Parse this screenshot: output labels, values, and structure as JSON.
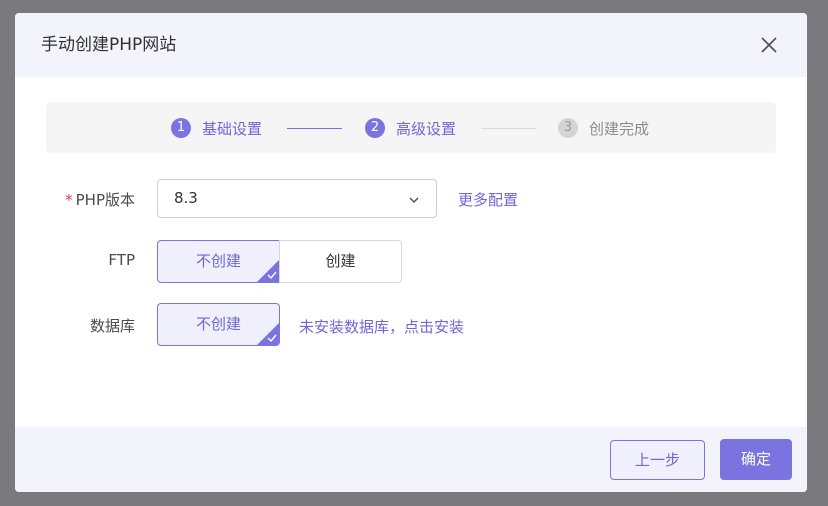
{
  "dialog": {
    "title": "手动创建PHP网站"
  },
  "steps": [
    {
      "num": "1",
      "label": "基础设置",
      "state": "done"
    },
    {
      "num": "2",
      "label": "高级设置",
      "state": "active"
    },
    {
      "num": "3",
      "label": "创建完成",
      "state": "pending"
    }
  ],
  "form": {
    "php": {
      "required_mark": "*",
      "label": "PHP版本",
      "value": "8.3",
      "more_link": "更多配置"
    },
    "ftp": {
      "label": "FTP",
      "options": [
        "不创建",
        "创建"
      ],
      "selected": "不创建"
    },
    "database": {
      "label": "数据库",
      "options": [
        "不创建"
      ],
      "selected": "不创建",
      "install_link": "未安装数据库，点击安装"
    }
  },
  "footer": {
    "prev_label": "上一步",
    "confirm_label": "确定"
  },
  "colors": {
    "accent": "#7b73e0",
    "accent_text": "#6f66d8",
    "required": "#e0383e"
  },
  "icons": {
    "close": "close-icon",
    "dropdown": "chevron-down-icon",
    "selected_mark": "check-icon"
  }
}
